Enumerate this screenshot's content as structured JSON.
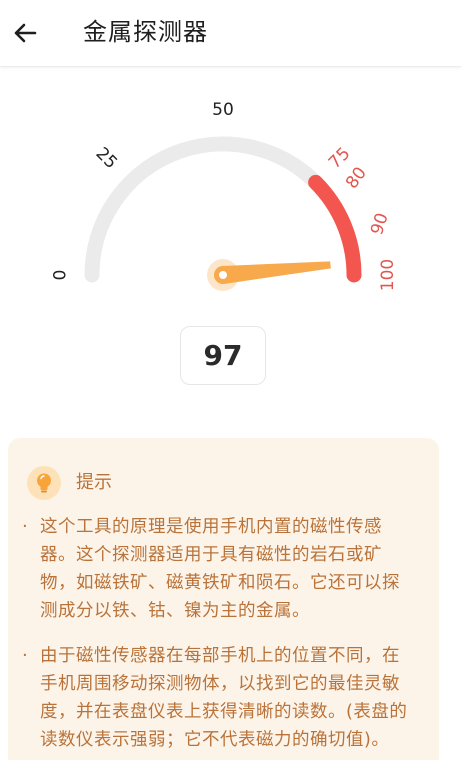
{
  "header": {
    "back_icon": "arrow-left-icon",
    "title": "金属探测器"
  },
  "gauge": {
    "min": 0,
    "max": 100,
    "value": 97,
    "danger_from": 75,
    "labels": [
      {
        "text": "0",
        "value": 0,
        "danger": false
      },
      {
        "text": "25",
        "value": 25,
        "danger": false
      },
      {
        "text": "50",
        "value": 50,
        "danger": false
      },
      {
        "text": "75",
        "value": 75,
        "danger": true
      },
      {
        "text": "80",
        "value": 80,
        "danger": true
      },
      {
        "text": "90",
        "value": 90,
        "danger": true
      },
      {
        "text": "100",
        "value": 100,
        "danger": true
      }
    ],
    "colors": {
      "track": "#ebebeb",
      "danger": "#f2564f",
      "needle": "#f7a94b",
      "label": "#222222",
      "danger_label": "#e2564f"
    }
  },
  "reading": "97",
  "tips": {
    "icon": "lightbulb-icon",
    "title": "提示",
    "bullet": "·",
    "items": [
      {
        "lines": [
          "这个工具的原理是使用手机内置的磁性传感",
          "器。这个探测器适用于具有磁性的岩石或矿",
          "物，如磁铁矿、磁黄铁矿和陨石。它还可以探",
          "测成分以铁、钴、镍为主的金属。"
        ]
      },
      {
        "lines": [
          "由于磁性传感器在每部手机上的位置不同，在",
          "手机周围移动探测物体，以找到它的最佳灵敏",
          "度，并在表盘仪表上获得清晰的读数。(表盘的",
          "读数仪表示强弱；它不代表磁力的确切值)。"
        ]
      }
    ]
  }
}
